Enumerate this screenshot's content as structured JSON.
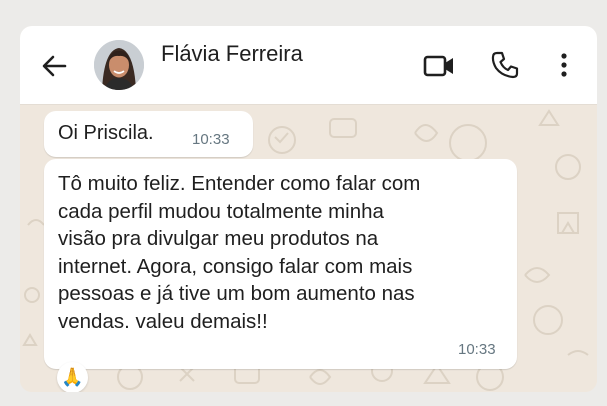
{
  "header": {
    "contact_name": "Flávia Ferreira",
    "icons": [
      "back-arrow-icon",
      "avatar-photo",
      "video-call-icon",
      "phone-call-icon",
      "more-options-icon"
    ]
  },
  "messages": [
    {
      "text": "Oi Priscila.",
      "time": "10:33"
    },
    {
      "text": "Tô muito feliz. Entender como falar com\ncada perfil mudou totalmente minha\nvisão pra divulgar meu produtos na\ninternet. Agora, consigo falar com mais\npessoas e já tive um bom aumento nas\nvendas. valeu demais!!",
      "time": "10:33",
      "reaction": "🙏"
    }
  ],
  "colors": {
    "header_bg": "#ffffff",
    "chat_bg": "#efe7dd",
    "bubble_bg": "#ffffff",
    "timestamp": "#667781",
    "text": "#1f1f1f"
  }
}
